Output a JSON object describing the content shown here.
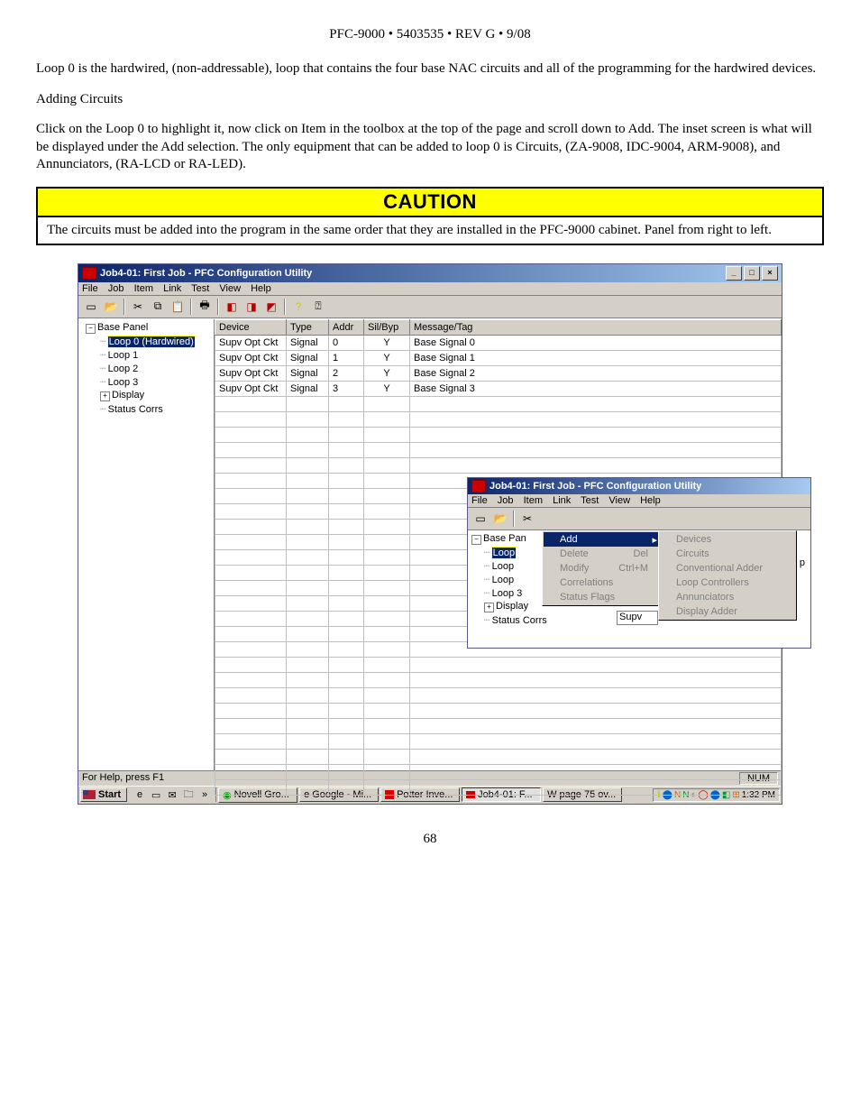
{
  "header": "PFC-9000 • 5403535 • REV G • 9/08",
  "para1": "Loop 0 is the hardwired, (non-addressable), loop that contains the four base NAC circuits and all of the programming for the hardwired devices.",
  "sub1": "Adding Circuits",
  "para2": "Click on the Loop 0 to highlight it, now click on Item in the toolbox at the top of the page and scroll down to Add. The inset screen is what will be displayed under the Add selection. The only equipment that can be added to loop 0 is Circuits, (ZA-9008, IDC-9004, ARM-9008), and Annunciators, (RA-LCD or RA-LED).",
  "caution": {
    "title": "CAUTION",
    "body": "The circuits must be added into the program in the same order that they are installed in the PFC-9000 cabinet. Panel from right to left."
  },
  "app": {
    "title": "Job4-01: First Job - PFC Configuration Utility",
    "menus": [
      "File",
      "Job",
      "Item",
      "Link",
      "Test",
      "View",
      "Help"
    ],
    "tree": {
      "root": "Base Panel",
      "items": [
        "Loop 0  (Hardwired)",
        "Loop 1",
        "Loop 2",
        "Loop 3",
        "Display",
        "Status Corrs"
      ]
    },
    "columns": [
      "Device",
      "Type",
      "Addr",
      "Sil/Byp",
      "Message/Tag"
    ],
    "rows": [
      {
        "device": "Supv Opt Ckt",
        "type": "Signal",
        "addr": "0",
        "sil": "Y",
        "msg": "Base Signal 0"
      },
      {
        "device": "Supv Opt Ckt",
        "type": "Signal",
        "addr": "1",
        "sil": "Y",
        "msg": "Base Signal 1"
      },
      {
        "device": "Supv Opt Ckt",
        "type": "Signal",
        "addr": "2",
        "sil": "Y",
        "msg": "Base Signal 2"
      },
      {
        "device": "Supv Opt Ckt",
        "type": "Signal",
        "addr": "3",
        "sil": "Y",
        "msg": "Base Signal 3"
      }
    ],
    "status_left": "For Help, press F1",
    "status_right": "NUM"
  },
  "inset": {
    "title": "Job4-01: First Job - PFC Configuration Utility",
    "menus": [
      "File",
      "Job",
      "Item",
      "Link",
      "Test",
      "View",
      "Help"
    ],
    "tree_root": "Base Pan",
    "tree_items": [
      "Loop",
      "Loop",
      "Loop",
      "Loop 3",
      "Display",
      "Status Corrs"
    ],
    "item_menu": [
      {
        "label": "Add",
        "shortcut": "",
        "hi": true,
        "arrow": true
      },
      {
        "label": "Delete",
        "shortcut": "Del"
      },
      {
        "label": "Modify",
        "shortcut": "Ctrl+M"
      },
      {
        "label": "Correlations",
        "shortcut": ""
      },
      {
        "label": "Status Flags",
        "shortcut": ""
      }
    ],
    "add_submenu": [
      "Devices",
      "Circuits",
      "Conventional Adder",
      "Loop Controllers",
      "Annunciators",
      "Display Adder"
    ],
    "supv_cell": "Supv",
    "p_frag": "p"
  },
  "taskbar": {
    "start": "Start",
    "tasks": [
      {
        "label": "Novell Gro...",
        "active": false
      },
      {
        "label": "Google - Mi...",
        "active": false
      },
      {
        "label": "Potter Inve...",
        "active": false
      },
      {
        "label": "Job4-01: F...",
        "active": true
      },
      {
        "label": "page 75 ov...",
        "active": false
      }
    ],
    "time": "1:32 PM"
  },
  "pagenum": "68"
}
